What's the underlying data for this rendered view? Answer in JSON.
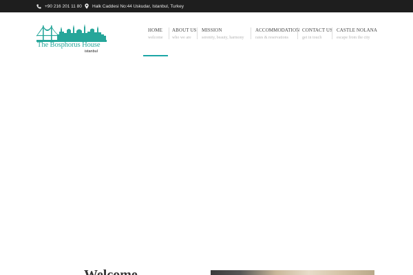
{
  "topbar": {
    "phone": "+90 216 201 11 80",
    "address": "Halk Caddesi No:44 Uskudar, Istanbul, Turkey"
  },
  "logo": {
    "name": "The Bosphorus House",
    "sub": "istanbul"
  },
  "nav": {
    "items": [
      {
        "label": "HOME",
        "sub": "welcome"
      },
      {
        "label": "ABOUT US",
        "sub": "who we are"
      },
      {
        "label": "MISSION",
        "sub": "serenity, beauty, harmony"
      },
      {
        "label": "ACCOMMODATION",
        "sub": "rates & reservations"
      },
      {
        "label": "CONTACT US",
        "sub": "get in touch"
      },
      {
        "label": "CASTLE NOLANA",
        "sub": "escape from the city"
      }
    ]
  },
  "colors": {
    "accent": "#1aa5a5",
    "topbar": "#1e1e1e"
  },
  "main": {
    "heading_partial": "Welcome"
  }
}
